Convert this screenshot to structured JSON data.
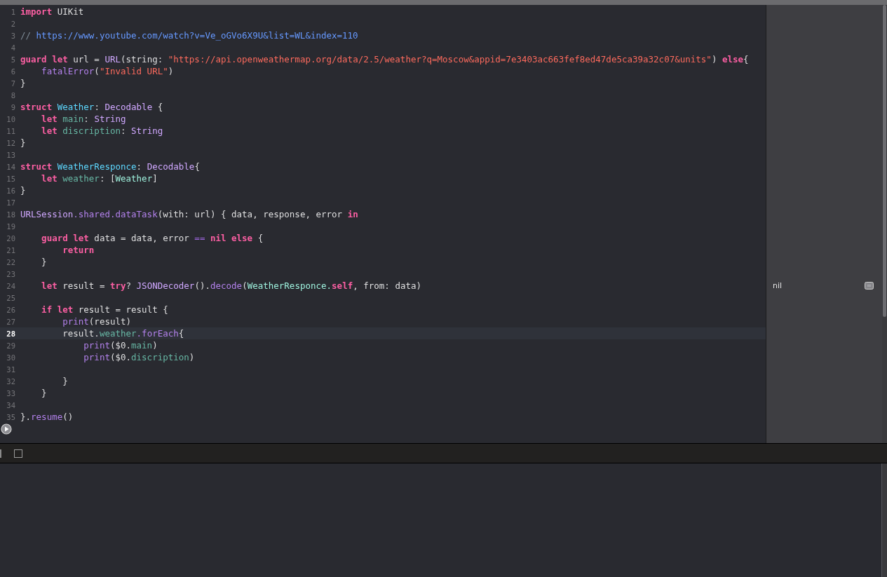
{
  "editor": {
    "lines": [
      {
        "number": "1",
        "current": false,
        "tokens": [
          {
            "t": "import",
            "kind": "kw"
          },
          {
            "t": " UIKit",
            "kind": "plain"
          }
        ]
      },
      {
        "number": "2",
        "current": false
      },
      {
        "number": "3",
        "current": false,
        "tokens": [
          {
            "t": "// ",
            "kind": "comment"
          },
          {
            "t": "https://www.youtube.com/watch?v=Ve_oGVo6X9U&list=WL&index=110",
            "kind": "link"
          }
        ]
      },
      {
        "number": "4",
        "current": false
      },
      {
        "number": "5",
        "current": false,
        "tokens": [
          {
            "t": "guard let ",
            "kind": "kw"
          },
          {
            "t": "url = ",
            "kind": "plain"
          },
          {
            "t": "URL",
            "kind": "sys"
          },
          {
            "t": "(string: ",
            "kind": "plain"
          },
          {
            "t": "\"https://api.openweathermap.org/data/2.5/weather?q=Moscow&appid=7e3403ac663fef8ed47de5ca39a32c07&units\"",
            "kind": "str"
          },
          {
            "t": ") ",
            "kind": "plain"
          },
          {
            "t": "else",
            "kind": "kw"
          },
          {
            "t": "{",
            "kind": "plain"
          }
        ]
      },
      {
        "number": "6",
        "current": false,
        "tokens": [
          {
            "t": "    fatalError",
            "kind": "fn"
          },
          {
            "t": "(",
            "kind": "plain"
          },
          {
            "t": "\"Invalid URL\"",
            "kind": "str"
          },
          {
            "t": ")",
            "kind": "plain"
          }
        ]
      },
      {
        "number": "7",
        "current": false,
        "tokens": [
          {
            "t": "}",
            "kind": "plain"
          }
        ]
      },
      {
        "number": "8",
        "current": false
      },
      {
        "number": "9",
        "current": false,
        "tokens": [
          {
            "t": "struct ",
            "kind": "kw"
          },
          {
            "t": "Weather",
            "kind": "decl"
          },
          {
            "t": ": ",
            "kind": "plain"
          },
          {
            "t": "Decodable",
            "kind": "sys"
          },
          {
            "t": " {",
            "kind": "plain"
          }
        ]
      },
      {
        "number": "10",
        "current": false,
        "tokens": [
          {
            "t": "    let ",
            "kind": "kw"
          },
          {
            "t": "main",
            "kind": "prop"
          },
          {
            "t": ": ",
            "kind": "plain"
          },
          {
            "t": "String",
            "kind": "sys"
          }
        ]
      },
      {
        "number": "11",
        "current": false,
        "tokens": [
          {
            "t": "    let ",
            "kind": "kw"
          },
          {
            "t": "discription",
            "kind": "prop"
          },
          {
            "t": ": ",
            "kind": "plain"
          },
          {
            "t": "String",
            "kind": "sys"
          }
        ]
      },
      {
        "number": "12",
        "current": false,
        "tokens": [
          {
            "t": "}",
            "kind": "plain"
          }
        ]
      },
      {
        "number": "13",
        "current": false
      },
      {
        "number": "14",
        "current": false,
        "tokens": [
          {
            "t": "struct ",
            "kind": "kw"
          },
          {
            "t": "WeatherResponce",
            "kind": "decl"
          },
          {
            "t": ": ",
            "kind": "plain"
          },
          {
            "t": "Decodable",
            "kind": "sys"
          },
          {
            "t": "{",
            "kind": "plain"
          }
        ]
      },
      {
        "number": "15",
        "current": false,
        "tokens": [
          {
            "t": "    let ",
            "kind": "kw"
          },
          {
            "t": "weather",
            "kind": "prop"
          },
          {
            "t": ": [",
            "kind": "plain"
          },
          {
            "t": "Weather",
            "kind": "proj"
          },
          {
            "t": "]",
            "kind": "plain"
          }
        ]
      },
      {
        "number": "16",
        "current": false,
        "tokens": [
          {
            "t": "}",
            "kind": "plain"
          }
        ]
      },
      {
        "number": "17",
        "current": false
      },
      {
        "number": "18",
        "current": false,
        "tokens": [
          {
            "t": "URLSession",
            "kind": "sys"
          },
          {
            "t": ".shared.dataTask",
            "kind": "fn"
          },
          {
            "t": "(with: url) { data, response, error ",
            "kind": "plain"
          },
          {
            "t": "in",
            "kind": "kw"
          }
        ]
      },
      {
        "number": "19",
        "current": false
      },
      {
        "number": "20",
        "current": false,
        "tokens": [
          {
            "t": "    guard let ",
            "kind": "kw"
          },
          {
            "t": "data = data, error ",
            "kind": "plain"
          },
          {
            "t": "== ",
            "kind": "op"
          },
          {
            "t": "nil else",
            "kind": "kw"
          },
          {
            "t": " {",
            "kind": "plain"
          }
        ]
      },
      {
        "number": "21",
        "current": false,
        "tokens": [
          {
            "t": "        return",
            "kind": "kw"
          }
        ]
      },
      {
        "number": "22",
        "current": false,
        "tokens": [
          {
            "t": "    }",
            "kind": "plain"
          }
        ]
      },
      {
        "number": "23",
        "current": false
      },
      {
        "number": "24",
        "current": false,
        "result": "nil",
        "tokens": [
          {
            "t": "    let ",
            "kind": "kw"
          },
          {
            "t": "result = ",
            "kind": "plain"
          },
          {
            "t": "try",
            "kind": "kw"
          },
          {
            "t": "? ",
            "kind": "plain"
          },
          {
            "t": "JSONDecoder",
            "kind": "sys"
          },
          {
            "t": "().",
            "kind": "plain"
          },
          {
            "t": "decode",
            "kind": "fn"
          },
          {
            "t": "(",
            "kind": "plain"
          },
          {
            "t": "WeatherResponce.",
            "kind": "proj"
          },
          {
            "t": "self",
            "kind": "kw"
          },
          {
            "t": ", from: data)",
            "kind": "plain"
          }
        ]
      },
      {
        "number": "25",
        "current": false
      },
      {
        "number": "26",
        "current": false,
        "tokens": [
          {
            "t": "    if let ",
            "kind": "kw"
          },
          {
            "t": "result = result {",
            "kind": "plain"
          }
        ]
      },
      {
        "number": "27",
        "current": false,
        "tokens": [
          {
            "t": "        print",
            "kind": "fn"
          },
          {
            "t": "(result)",
            "kind": "plain"
          }
        ]
      },
      {
        "number": "28",
        "current": true,
        "tokens": [
          {
            "t": "        result.",
            "kind": "plain"
          },
          {
            "t": "weather",
            "kind": "prop"
          },
          {
            "t": ".forEach",
            "kind": "fn"
          },
          {
            "t": "{",
            "kind": "plain"
          }
        ]
      },
      {
        "number": "29",
        "current": false,
        "tokens": [
          {
            "t": "            print",
            "kind": "fn"
          },
          {
            "t": "($0.",
            "kind": "plain"
          },
          {
            "t": "main",
            "kind": "prop"
          },
          {
            "t": ")",
            "kind": "plain"
          }
        ]
      },
      {
        "number": "30",
        "current": false,
        "tokens": [
          {
            "t": "            print",
            "kind": "fn"
          },
          {
            "t": "($0.",
            "kind": "plain"
          },
          {
            "t": "discription",
            "kind": "prop"
          },
          {
            "t": ")",
            "kind": "plain"
          }
        ]
      },
      {
        "number": "31",
        "current": false
      },
      {
        "number": "32",
        "current": false,
        "tokens": [
          {
            "t": "        }",
            "kind": "plain"
          }
        ]
      },
      {
        "number": "33",
        "current": false,
        "tokens": [
          {
            "t": "    }",
            "kind": "plain"
          }
        ]
      },
      {
        "number": "34",
        "current": false
      },
      {
        "number": "35",
        "current": false,
        "tokens": [
          {
            "t": "}.",
            "kind": "plain"
          },
          {
            "t": "resume",
            "kind": "fn"
          },
          {
            "t": "()",
            "kind": "plain"
          }
        ]
      }
    ]
  }
}
